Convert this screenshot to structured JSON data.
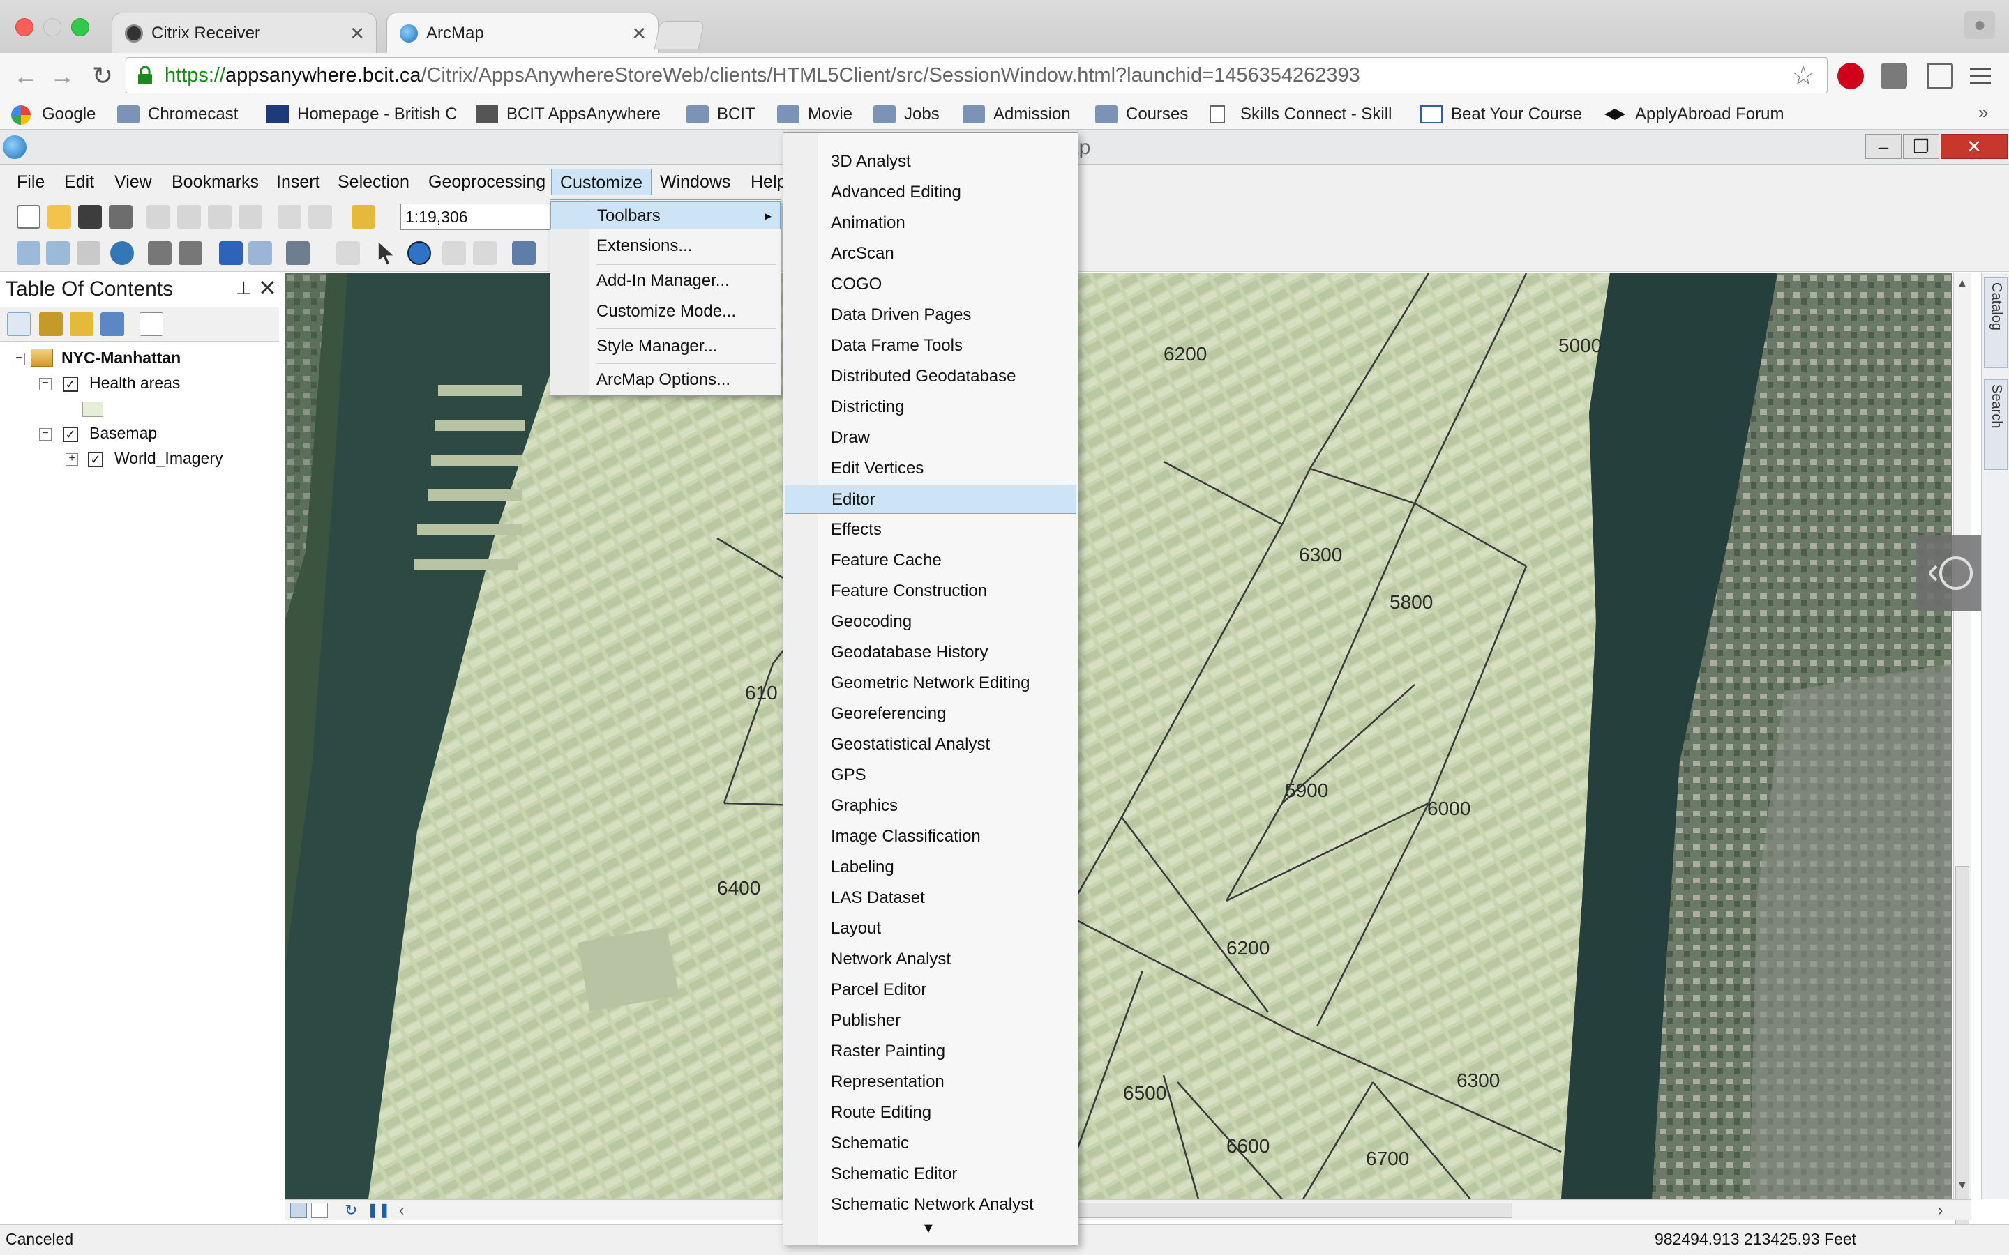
{
  "browser": {
    "tabs": [
      {
        "title": "Citrix Receiver",
        "active": false
      },
      {
        "title": "ArcMap",
        "active": true
      }
    ],
    "url_secure": "https://",
    "url_host": "appsanywhere.bcit.ca",
    "url_path": "/Citrix/AppsAnywhereStoreWeb/clients/HTML5Client/src/SessionWindow.html?launchid=1456354262393",
    "bookmarks": [
      "Google",
      "Chromecast",
      "Homepage - British C",
      "BCIT AppsAnywhere",
      "BCIT",
      "Movie",
      "Jobs",
      "Admission",
      "Courses",
      "Skills Connect - Skill",
      "Beat Your Course",
      "ApplyAbroad Forum"
    ],
    "more_label": "»"
  },
  "app": {
    "title": "ap",
    "menu": [
      "File",
      "Edit",
      "View",
      "Bookmarks",
      "Insert",
      "Selection",
      "Geoprocessing",
      "Customize",
      "Windows",
      "Help"
    ],
    "scale": "1:19,306"
  },
  "toc": {
    "title": "Table Of Contents",
    "pin": "⊥",
    "close": "✕",
    "root": "NYC-Manhattan",
    "layers": [
      {
        "name": "Health areas",
        "checked": true
      },
      {
        "name": "Basemap",
        "checked": true
      },
      {
        "name": "World_Imagery",
        "checked": true
      }
    ]
  },
  "customize_menu": {
    "items": [
      "Toolbars",
      "Extensions...",
      "Add-In Manager...",
      "Customize Mode...",
      "Style Manager...",
      "ArcMap Options..."
    ],
    "highlighted": "Toolbars",
    "arrow": "▸"
  },
  "toolbars_menu": {
    "items": [
      "3D Analyst",
      "Advanced Editing",
      "Animation",
      "ArcScan",
      "COGO",
      "Data Driven Pages",
      "Data Frame Tools",
      "Distributed Geodatabase",
      "Districting",
      "Draw",
      "Edit Vertices",
      "Editor",
      "Effects",
      "Feature Cache",
      "Feature Construction",
      "Geocoding",
      "Geodatabase History",
      "Geometric Network Editing",
      "Georeferencing",
      "Geostatistical Analyst",
      "GPS",
      "Graphics",
      "Image Classification",
      "Labeling",
      "LAS Dataset",
      "Layout",
      "Network Analyst",
      "Parcel Editor",
      "Publisher",
      "Raster Painting",
      "Representation",
      "Route Editing",
      "Schematic",
      "Schematic Editor",
      "Schematic Network Analyst"
    ],
    "highlighted": "Editor",
    "scroll_glyph": "▼"
  },
  "map": {
    "labels": [
      "6200",
      "5000",
      "6300",
      "5800",
      "610",
      "5900",
      "6000",
      "6400",
      "6200",
      "6500",
      "6300",
      "6600",
      "6700"
    ]
  },
  "side_panels": [
    "Catalog",
    "Search"
  ],
  "status": {
    "text": "Canceled",
    "coords": "982494.913  213425.93 Feet"
  },
  "colors": {
    "highlight": "#cde4f7",
    "highlight_border": "#7aa9d6",
    "url_green": "#1a8a1a",
    "close_red": "#c9372c"
  }
}
